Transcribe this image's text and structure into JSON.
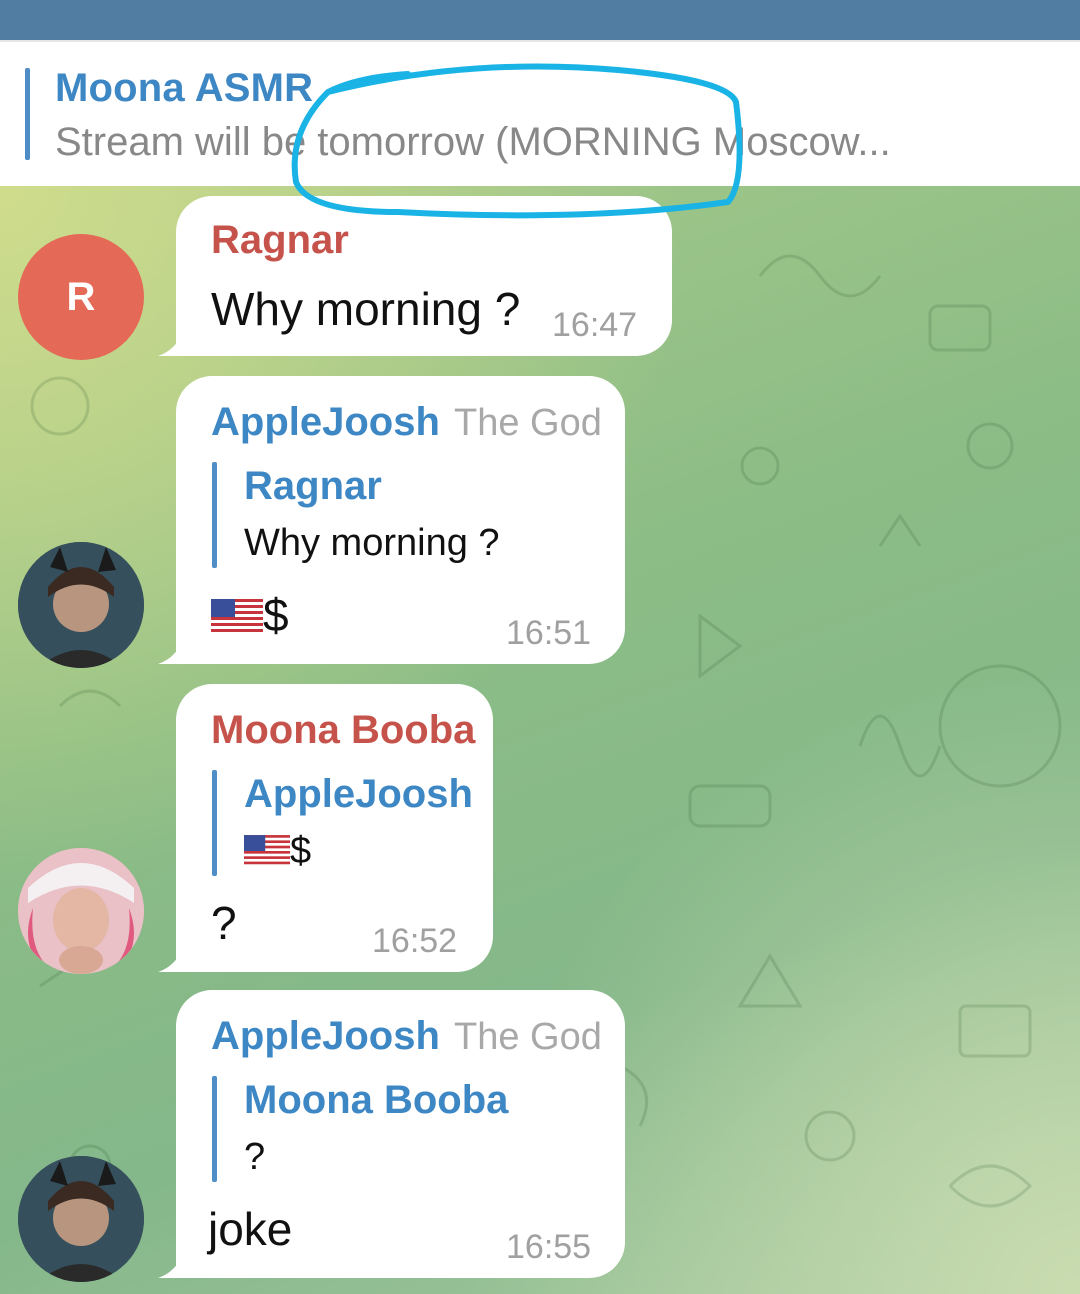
{
  "pinned": {
    "title": "Moona ASMR",
    "text": "Stream will be tomorrow (MORNING Moscow..."
  },
  "messages": [
    {
      "sender": "Ragnar",
      "avatar_letter": "R",
      "text": "Why morning ?",
      "time": "16:47"
    },
    {
      "sender": "AppleJoosh",
      "role": "The God",
      "reply_name": "Ragnar",
      "reply_text": "Why morning ?",
      "text": "$",
      "time": "16:51"
    },
    {
      "sender": "Moona Booba",
      "reply_name": "AppleJoosh",
      "reply_text": "$",
      "text": "?",
      "time": "16:52"
    },
    {
      "sender": "AppleJoosh",
      "role": "The God",
      "reply_name": "Moona Booba",
      "reply_text": "?",
      "text": "joke",
      "time": "16:55"
    }
  ],
  "colors": {
    "header": "#527da3",
    "accent_blue": "#3d87c4",
    "sender_red": "#c6534b",
    "annotation": "#19b3e6"
  },
  "icons": [
    "us-flag-icon"
  ]
}
